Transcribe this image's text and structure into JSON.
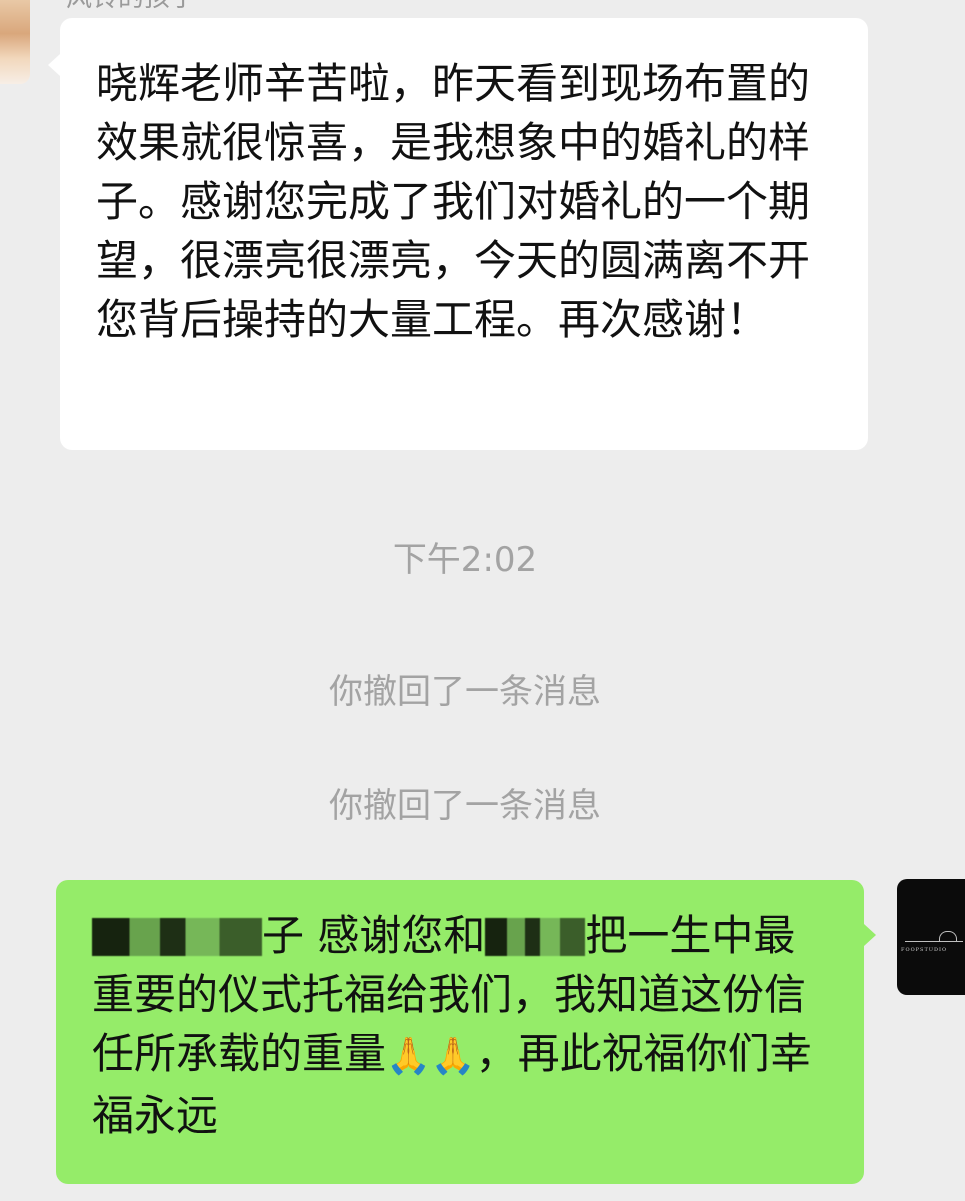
{
  "incoming": {
    "sender_name": "风铃的孩子",
    "text": "晓辉老师辛苦啦，昨天看到现场布置的效果就很惊喜，是我想象中的婚礼的样子。感谢您完成了我们对婚礼的一个期望，很漂亮很漂亮，今天的圆满离不开您背后操持的大量工程。再次感谢！"
  },
  "timestamp": "下午2:02",
  "system_messages": [
    "你撤回了一条消息",
    "你撤回了一条消息"
  ],
  "outgoing": {
    "part_1": "子 感谢您和",
    "part_2": "把一生中最重要的仪式托福给我们，我知道这份信任所承载的重量",
    "emoji_1": "🙏",
    "emoji_2": "🙏",
    "part_3": "，再此祝福你们幸福永远"
  },
  "self_avatar": {
    "brand_text": "FOOPSTUDIO"
  },
  "colors": {
    "background": "#ededed",
    "incoming_bubble": "#ffffff",
    "outgoing_bubble": "#95ec69",
    "system_text": "#a3a3a3"
  }
}
